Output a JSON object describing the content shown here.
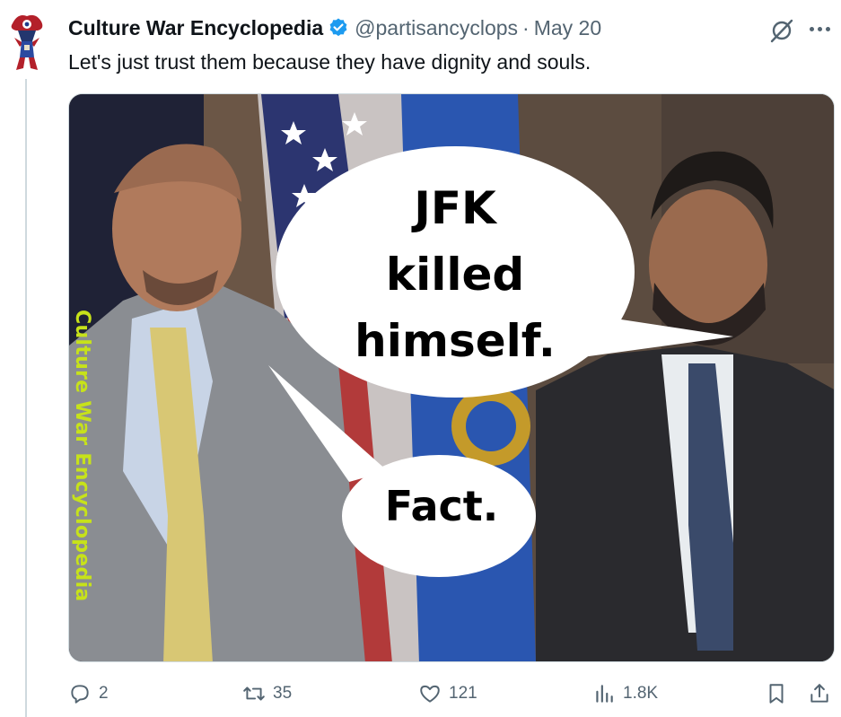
{
  "tweet": {
    "author": {
      "display_name": "Culture War Encyclopedia",
      "verified": true,
      "handle": "@partisancyclops",
      "avatar_icon": "cyclops-avatar-icon"
    },
    "separator": "·",
    "date": "May 20",
    "text": "Let's just trust them because they have dignity and souls.",
    "media": {
      "watermark": "Culture War Encyclopedia",
      "speech_bubble_large": "JFK killed himself.",
      "speech_bubble_large_lines": [
        "JFK",
        "killed",
        "himself."
      ],
      "speech_bubble_small": "Fact."
    },
    "actions": {
      "replies": "2",
      "retweets": "35",
      "likes": "121",
      "views": "1.8K"
    }
  },
  "colors": {
    "text_primary": "#0f1419",
    "text_secondary": "#536471",
    "verified_blue": "#1d9bf0",
    "watermark_green": "#c7e21a",
    "thread_line": "#cfd9de"
  },
  "icons": {
    "header": [
      "grok-icon",
      "more-icon"
    ],
    "actions": [
      "reply-icon",
      "retweet-icon",
      "like-icon",
      "views-icon",
      "bookmark-icon",
      "share-icon"
    ]
  }
}
